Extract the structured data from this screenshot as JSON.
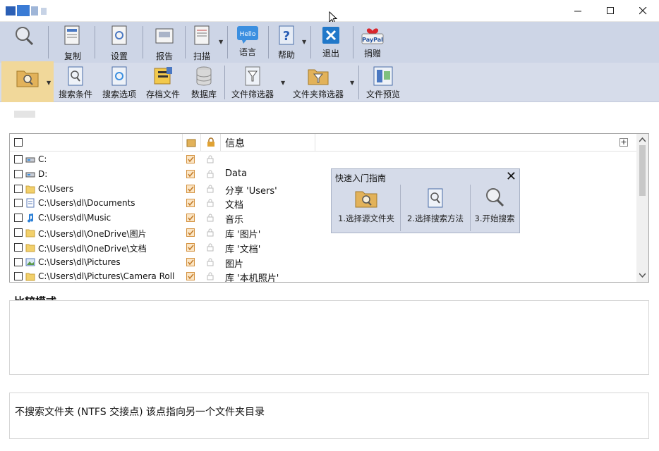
{
  "titlebar": {
    "minimize_icon": "minimize-icon",
    "maximize_icon": "maximize-icon",
    "close_icon": "close-icon"
  },
  "toolbar_main": {
    "items": [
      {
        "label": "",
        "icon": "search-magnifier-icon"
      },
      {
        "label": "复制",
        "icon": "copy-report-icon"
      },
      {
        "label": "设置",
        "icon": "settings-doc-icon"
      },
      {
        "label": "报告",
        "icon": "report-icon"
      },
      {
        "label": "扫描",
        "icon": "scan-doc-icon"
      },
      {
        "label": "语言",
        "icon": "hello-language-icon"
      },
      {
        "label": "帮助",
        "icon": "help-icon"
      },
      {
        "label": "退出",
        "icon": "exit-icon"
      },
      {
        "label": "捐赠",
        "icon": "paypal-donate-icon"
      }
    ],
    "hello_text": "Hello",
    "paypal_text": "PayPal"
  },
  "toolbar_search": {
    "items": [
      {
        "label": "",
        "icon": "source-folder-icon"
      },
      {
        "label": "搜索条件",
        "icon": "search-criteria-icon"
      },
      {
        "label": "搜索选项",
        "icon": "search-options-icon"
      },
      {
        "label": "存档文件",
        "icon": "archive-files-icon"
      },
      {
        "label": "数据库",
        "icon": "database-icon"
      },
      {
        "label": "文件筛选器",
        "icon": "file-filter-icon"
      },
      {
        "label": "文件夹筛选器",
        "icon": "folder-filter-icon"
      },
      {
        "label": "文件预览",
        "icon": "file-preview-icon"
      }
    ]
  },
  "file_list": {
    "header": {
      "info": "信息"
    },
    "rows": [
      {
        "path": "C:",
        "info": "",
        "icon": "drive-icon"
      },
      {
        "path": "D:",
        "info": "Data",
        "icon": "drive-icon"
      },
      {
        "path": "C:\\Users",
        "info": "分享 'Users'",
        "icon": "folder-icon"
      },
      {
        "path": "C:\\Users\\dl\\Documents",
        "info": "文档",
        "icon": "document-icon"
      },
      {
        "path": "C:\\Users\\dl\\Music",
        "info": "音乐",
        "icon": "music-icon"
      },
      {
        "path": "C:\\Users\\dl\\OneDrive\\图片",
        "info": "库 '图片'",
        "icon": "folder-icon"
      },
      {
        "path": "C:\\Users\\dl\\OneDrive\\文档",
        "info": "库 '文档'",
        "icon": "folder-icon"
      },
      {
        "path": "C:\\Users\\dl\\Pictures",
        "info": "图片",
        "icon": "pictures-icon"
      },
      {
        "path": "C:\\Users\\dl\\Pictures\\Camera Roll",
        "info": "库 '本机照片'",
        "icon": "folder-icon"
      }
    ]
  },
  "quick_guide": {
    "title": "快速入门指南",
    "steps": [
      {
        "label": "1.选择源文件夹",
        "icon": "source-folder-icon"
      },
      {
        "label": "2.选择搜索方法",
        "icon": "search-method-icon"
      },
      {
        "label": "3.开始搜索",
        "icon": "magnifier-icon"
      }
    ]
  },
  "compare_section": {
    "title": "比较模式"
  },
  "bottom_panel": {
    "text": "不搜索文件夹 (NTFS 交接点) 该点指向另一个文件夹目录"
  }
}
